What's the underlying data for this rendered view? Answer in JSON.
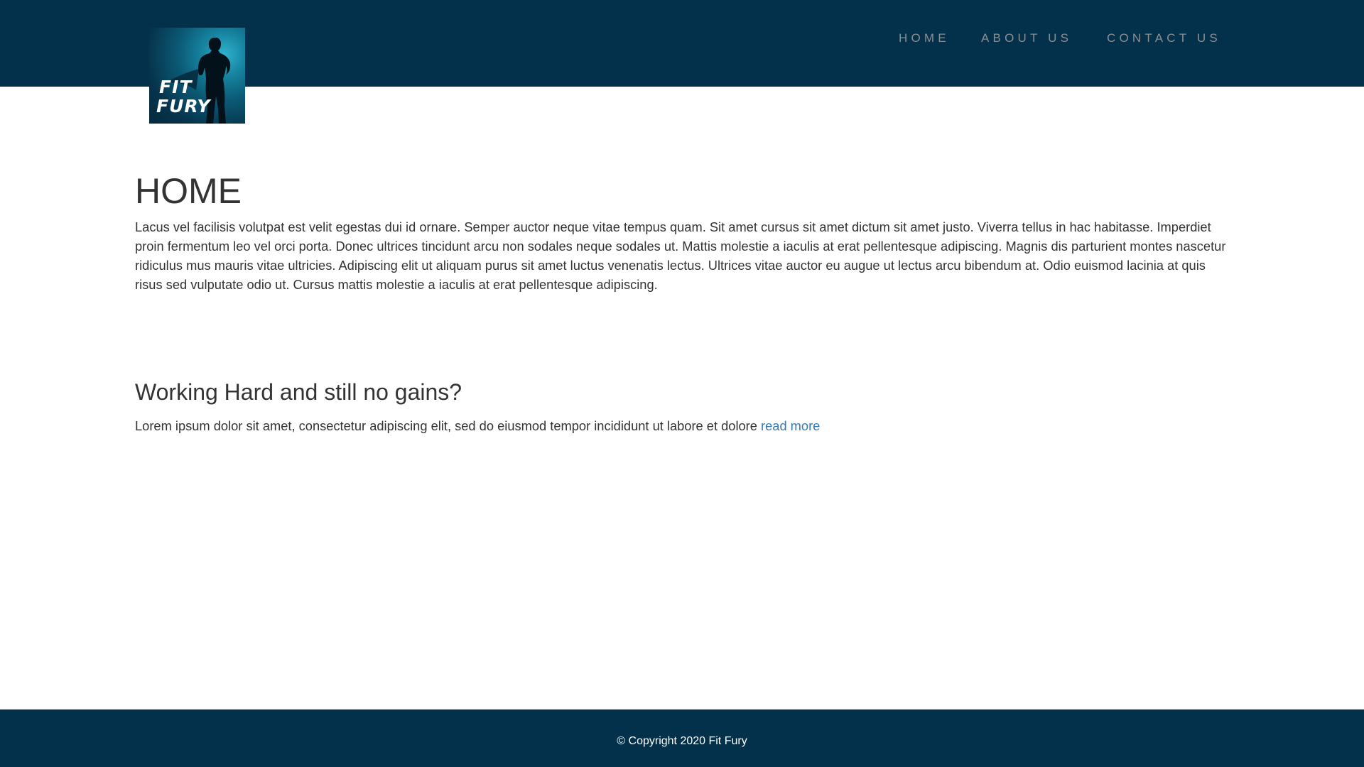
{
  "brand": {
    "logo_text_line1": "FIT",
    "logo_text_line2": "FURY"
  },
  "nav": {
    "items": [
      {
        "label": "HOME"
      },
      {
        "label": "ABOUT US"
      },
      {
        "label": "CONTACT US"
      }
    ]
  },
  "main": {
    "title": "HOME",
    "intro": "Lacus vel facilisis volutpat est velit egestas dui id ornare. Semper auctor neque vitae tempus quam. Sit amet cursus sit amet dictum sit amet justo. Viverra tellus in hac habitasse. Imperdiet proin fermentum leo vel orci porta. Donec ultrices tincidunt arcu non sodales neque sodales ut. Mattis molestie a iaculis at erat pellentesque adipiscing. Magnis dis parturient montes nascetur ridiculus mus mauris vitae ultricies. Adipiscing elit ut aliquam purus sit amet luctus venenatis lectus. Ultrices vitae auctor eu augue ut lectus arcu bibendum at. Odio euismod lacinia at quis risus sed vulputate odio ut. Cursus mattis molestie a iaculis at erat pellentesque adipiscing.",
    "section_title": "Working Hard and still no gains?",
    "teaser_text": "Lorem ipsum dolor sit amet, consectetur adipiscing elit, sed do eiusmod tempor incididunt ut labore et dolore ",
    "read_more_label": "read more"
  },
  "footer": {
    "copyright": "© Copyright 2020 Fit Fury"
  },
  "colors": {
    "header_bg": "#03304a",
    "footer_bg": "#03304a",
    "link": "#337ab7",
    "nav_text": "#8a8f93"
  }
}
